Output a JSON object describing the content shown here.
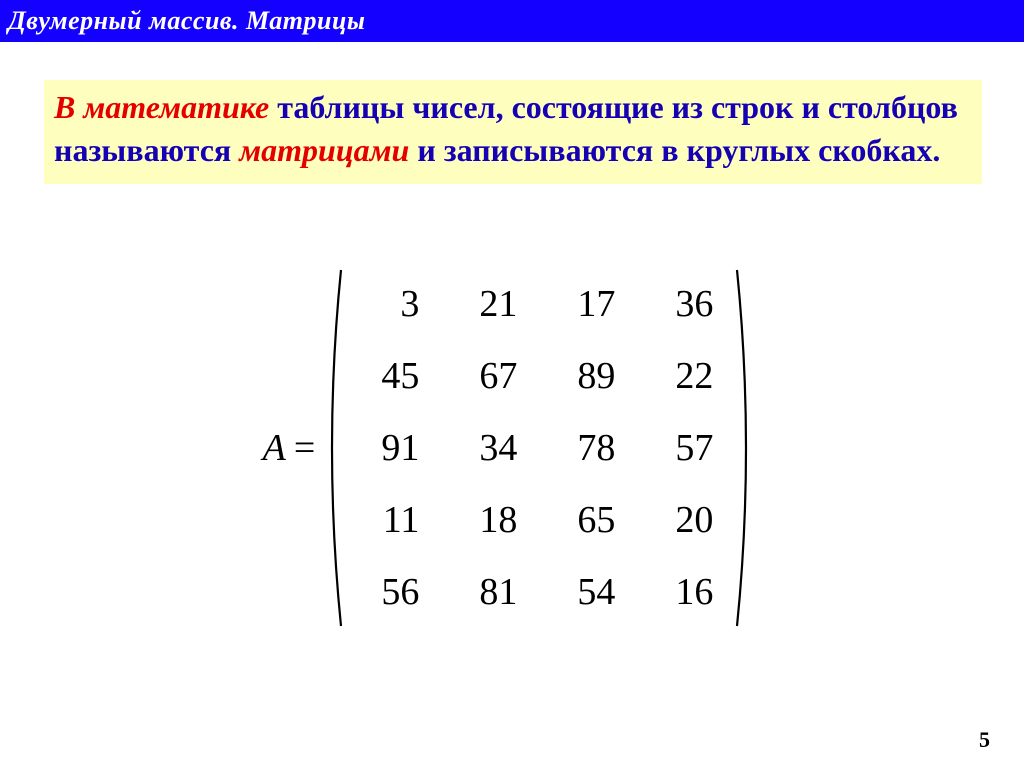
{
  "header": {
    "title": "Двумерный массив. Матрицы"
  },
  "callout": {
    "lead": "В математике",
    "part1": " таблицы чисел, состоящие из строк и столбцов называются ",
    "em": "матрицами",
    "part2": " и записываются в круглых скобках."
  },
  "matrix": {
    "label": "A",
    "eq": "=",
    "rows": [
      [
        "3",
        "21",
        "17",
        "36"
      ],
      [
        "45",
        "67",
        "89",
        "22"
      ],
      [
        "91",
        "34",
        "78",
        "57"
      ],
      [
        "11",
        "18",
        "65",
        "20"
      ],
      [
        "56",
        "81",
        "54",
        "16"
      ]
    ]
  },
  "page": {
    "number": "5"
  }
}
